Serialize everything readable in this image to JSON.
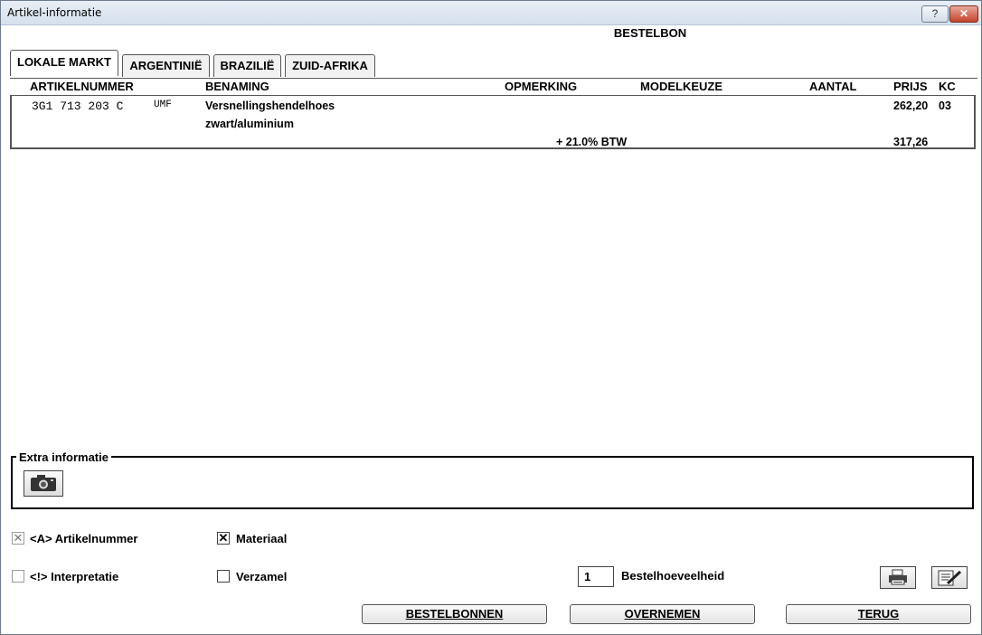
{
  "window": {
    "title": "Artikel-informatie",
    "help_label": "?",
    "close_label": "✕"
  },
  "document": {
    "title": "BESTELBON"
  },
  "tabs": [
    {
      "label": "LOKALE MARKT",
      "active": true
    },
    {
      "label": "ARGENTINIË",
      "active": false
    },
    {
      "label": "BRAZILIË",
      "active": false
    },
    {
      "label": "ZUID-AFRIKA",
      "active": false
    }
  ],
  "columns": {
    "artikelnummer": "ARTIKELNUMMER",
    "benaming": "BENAMING",
    "opmerking": "OPMERKING",
    "modelkeuze": "MODELKEUZE",
    "aantal": "AANTAL",
    "prijs": "PRIJS",
    "kc": "KC"
  },
  "row": {
    "artikelnummer": "3G1 713 203 C",
    "suffix": "UMF",
    "benaming_line1": "Versnellingshendelhoes",
    "benaming_line2": "zwart/aluminium",
    "prijs": "262,20",
    "kc": "03",
    "btw_label": "+ 21.0% BTW",
    "prijs_btw": "317,26"
  },
  "extra": {
    "label": "Extra informatie",
    "camera_icon": "camera-icon"
  },
  "options": {
    "artikelnummer": {
      "label": "<A> Artikelnummer",
      "checked": true,
      "enabled": false
    },
    "materiaal": {
      "label": "Materiaal",
      "checked": true,
      "enabled": true
    },
    "interpretatie": {
      "label": "<!> Interpretatie",
      "checked": false,
      "enabled": false
    },
    "verzamel": {
      "label": "Verzamel",
      "checked": false,
      "enabled": true
    }
  },
  "quantity": {
    "value": "1",
    "label": "Bestelhoeveelheid"
  },
  "buttons": {
    "bestelbonnen": "BESTELBONNEN",
    "overnemen": "OVERNEMEN",
    "terug": "TERUG"
  },
  "icons": {
    "print": "printer-icon",
    "edit": "edit-icon"
  }
}
